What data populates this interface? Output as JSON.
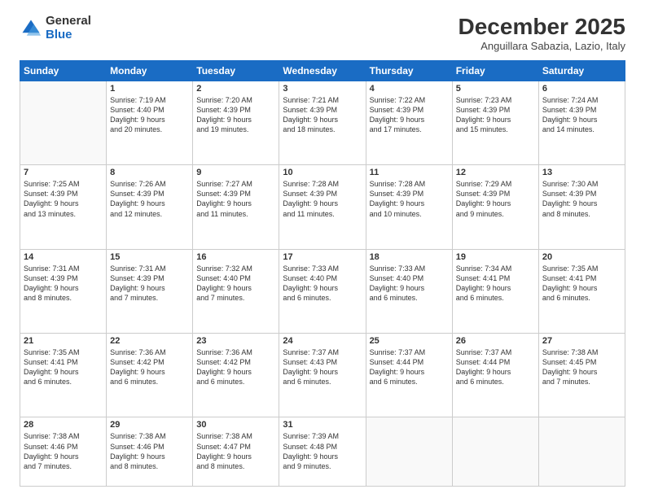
{
  "logo": {
    "general": "General",
    "blue": "Blue"
  },
  "title": "December 2025",
  "subtitle": "Anguillara Sabazia, Lazio, Italy",
  "days_of_week": [
    "Sunday",
    "Monday",
    "Tuesday",
    "Wednesday",
    "Thursday",
    "Friday",
    "Saturday"
  ],
  "weeks": [
    [
      {
        "day": "",
        "info": ""
      },
      {
        "day": "1",
        "info": "Sunrise: 7:19 AM\nSunset: 4:40 PM\nDaylight: 9 hours\nand 20 minutes."
      },
      {
        "day": "2",
        "info": "Sunrise: 7:20 AM\nSunset: 4:39 PM\nDaylight: 9 hours\nand 19 minutes."
      },
      {
        "day": "3",
        "info": "Sunrise: 7:21 AM\nSunset: 4:39 PM\nDaylight: 9 hours\nand 18 minutes."
      },
      {
        "day": "4",
        "info": "Sunrise: 7:22 AM\nSunset: 4:39 PM\nDaylight: 9 hours\nand 17 minutes."
      },
      {
        "day": "5",
        "info": "Sunrise: 7:23 AM\nSunset: 4:39 PM\nDaylight: 9 hours\nand 15 minutes."
      },
      {
        "day": "6",
        "info": "Sunrise: 7:24 AM\nSunset: 4:39 PM\nDaylight: 9 hours\nand 14 minutes."
      }
    ],
    [
      {
        "day": "7",
        "info": "Sunrise: 7:25 AM\nSunset: 4:39 PM\nDaylight: 9 hours\nand 13 minutes."
      },
      {
        "day": "8",
        "info": "Sunrise: 7:26 AM\nSunset: 4:39 PM\nDaylight: 9 hours\nand 12 minutes."
      },
      {
        "day": "9",
        "info": "Sunrise: 7:27 AM\nSunset: 4:39 PM\nDaylight: 9 hours\nand 11 minutes."
      },
      {
        "day": "10",
        "info": "Sunrise: 7:28 AM\nSunset: 4:39 PM\nDaylight: 9 hours\nand 11 minutes."
      },
      {
        "day": "11",
        "info": "Sunrise: 7:28 AM\nSunset: 4:39 PM\nDaylight: 9 hours\nand 10 minutes."
      },
      {
        "day": "12",
        "info": "Sunrise: 7:29 AM\nSunset: 4:39 PM\nDaylight: 9 hours\nand 9 minutes."
      },
      {
        "day": "13",
        "info": "Sunrise: 7:30 AM\nSunset: 4:39 PM\nDaylight: 9 hours\nand 8 minutes."
      }
    ],
    [
      {
        "day": "14",
        "info": "Sunrise: 7:31 AM\nSunset: 4:39 PM\nDaylight: 9 hours\nand 8 minutes."
      },
      {
        "day": "15",
        "info": "Sunrise: 7:31 AM\nSunset: 4:39 PM\nDaylight: 9 hours\nand 7 minutes."
      },
      {
        "day": "16",
        "info": "Sunrise: 7:32 AM\nSunset: 4:40 PM\nDaylight: 9 hours\nand 7 minutes."
      },
      {
        "day": "17",
        "info": "Sunrise: 7:33 AM\nSunset: 4:40 PM\nDaylight: 9 hours\nand 6 minutes."
      },
      {
        "day": "18",
        "info": "Sunrise: 7:33 AM\nSunset: 4:40 PM\nDaylight: 9 hours\nand 6 minutes."
      },
      {
        "day": "19",
        "info": "Sunrise: 7:34 AM\nSunset: 4:41 PM\nDaylight: 9 hours\nand 6 minutes."
      },
      {
        "day": "20",
        "info": "Sunrise: 7:35 AM\nSunset: 4:41 PM\nDaylight: 9 hours\nand 6 minutes."
      }
    ],
    [
      {
        "day": "21",
        "info": "Sunrise: 7:35 AM\nSunset: 4:41 PM\nDaylight: 9 hours\nand 6 minutes."
      },
      {
        "day": "22",
        "info": "Sunrise: 7:36 AM\nSunset: 4:42 PM\nDaylight: 9 hours\nand 6 minutes."
      },
      {
        "day": "23",
        "info": "Sunrise: 7:36 AM\nSunset: 4:42 PM\nDaylight: 9 hours\nand 6 minutes."
      },
      {
        "day": "24",
        "info": "Sunrise: 7:37 AM\nSunset: 4:43 PM\nDaylight: 9 hours\nand 6 minutes."
      },
      {
        "day": "25",
        "info": "Sunrise: 7:37 AM\nSunset: 4:44 PM\nDaylight: 9 hours\nand 6 minutes."
      },
      {
        "day": "26",
        "info": "Sunrise: 7:37 AM\nSunset: 4:44 PM\nDaylight: 9 hours\nand 6 minutes."
      },
      {
        "day": "27",
        "info": "Sunrise: 7:38 AM\nSunset: 4:45 PM\nDaylight: 9 hours\nand 7 minutes."
      }
    ],
    [
      {
        "day": "28",
        "info": "Sunrise: 7:38 AM\nSunset: 4:46 PM\nDaylight: 9 hours\nand 7 minutes."
      },
      {
        "day": "29",
        "info": "Sunrise: 7:38 AM\nSunset: 4:46 PM\nDaylight: 9 hours\nand 8 minutes."
      },
      {
        "day": "30",
        "info": "Sunrise: 7:38 AM\nSunset: 4:47 PM\nDaylight: 9 hours\nand 8 minutes."
      },
      {
        "day": "31",
        "info": "Sunrise: 7:39 AM\nSunset: 4:48 PM\nDaylight: 9 hours\nand 9 minutes."
      },
      {
        "day": "",
        "info": ""
      },
      {
        "day": "",
        "info": ""
      },
      {
        "day": "",
        "info": ""
      }
    ]
  ]
}
